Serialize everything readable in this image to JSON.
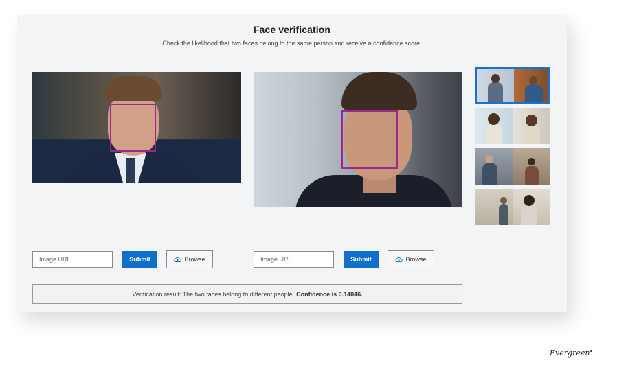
{
  "header": {
    "title": "Face verification",
    "subtitle": "Check the likelihood that two faces belong to the same person and receive a confidence score."
  },
  "panels": [
    {
      "url_placeholder": "Image URL",
      "submit_label": "Submit",
      "browse_label": "Browse",
      "browse_icon": "cloud-upload-icon"
    },
    {
      "url_placeholder": "Image URL",
      "submit_label": "Submit",
      "browse_label": "Browse",
      "browse_icon": "cloud-upload-icon"
    }
  ],
  "result": {
    "prefix": "Verification result: The two faces belong to different people.",
    "confidence": "Confidence is 0.14046."
  },
  "thumbnails": {
    "count": 4,
    "selected_index": 0
  },
  "colors": {
    "accent": "#0f6fcd",
    "face_box": "#a0268f",
    "panel_bg": "#f3f4f6",
    "thumb_selected": "#1a73c9"
  },
  "watermark": {
    "text": "Evergreen"
  }
}
